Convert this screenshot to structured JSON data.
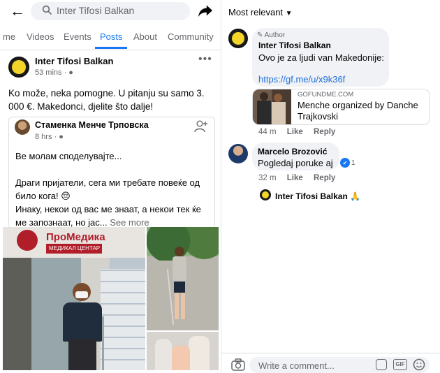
{
  "search": {
    "placeholder": "Inter Tifosi Balkan"
  },
  "tabs": [
    {
      "label": "me"
    },
    {
      "label": "Videos"
    },
    {
      "label": "Events"
    },
    {
      "label": "Posts"
    },
    {
      "label": "About"
    },
    {
      "label": "Community"
    }
  ],
  "post": {
    "author": "Inter Tifosi Balkan",
    "time": "53 mins · ●",
    "body": "Ko može, neka pomogne. U pitanju su samo 3. 000 €. Makedonci, djelite što dalje!",
    "shared": {
      "author": "Стаменка Менче Трповска",
      "time": "8 hrs · ●",
      "para1": "Ве молам споделувајте...",
      "para2": "Драги пријатели, сега ми требате повеќе од било кога! 😔",
      "para3": "Инаку, некои од вас ме знаат, а некои тек ќе ме запознаат, но јас...",
      "see_more": "See more"
    },
    "photo_sign": {
      "brand": "ПроМедика",
      "sub": "МЕДИКАЛ ЦЕНТАР"
    }
  },
  "comments": {
    "sort_label": "Most relevant",
    "c1": {
      "badge": "Author",
      "name": "Inter Tifosi Balkan",
      "text": "Ovo je za ljudi van Makedonije:",
      "link": "https://gf.me/u/x9k36f",
      "card_domain": "GOFUNDME.COM",
      "card_title": "Menche organized by Danche Trajkovski",
      "time": "44 m",
      "like": "Like",
      "reply": "Reply"
    },
    "c2": {
      "name": "Marcelo Brozović",
      "text": "Pogledaj poruke aj",
      "reaction_count": "1",
      "time": "32 m",
      "like": "Like",
      "reply": "Reply"
    },
    "reply_preview": {
      "name": "Inter Tifosi Balkan",
      "emoji": "🙏"
    }
  },
  "composer": {
    "placeholder": "Write a comment..."
  },
  "colors": {
    "accent": "#1877f2",
    "text_secondary": "#65676b",
    "bubble": "#f0f2f5",
    "logo_yellow": "#f2d528"
  }
}
